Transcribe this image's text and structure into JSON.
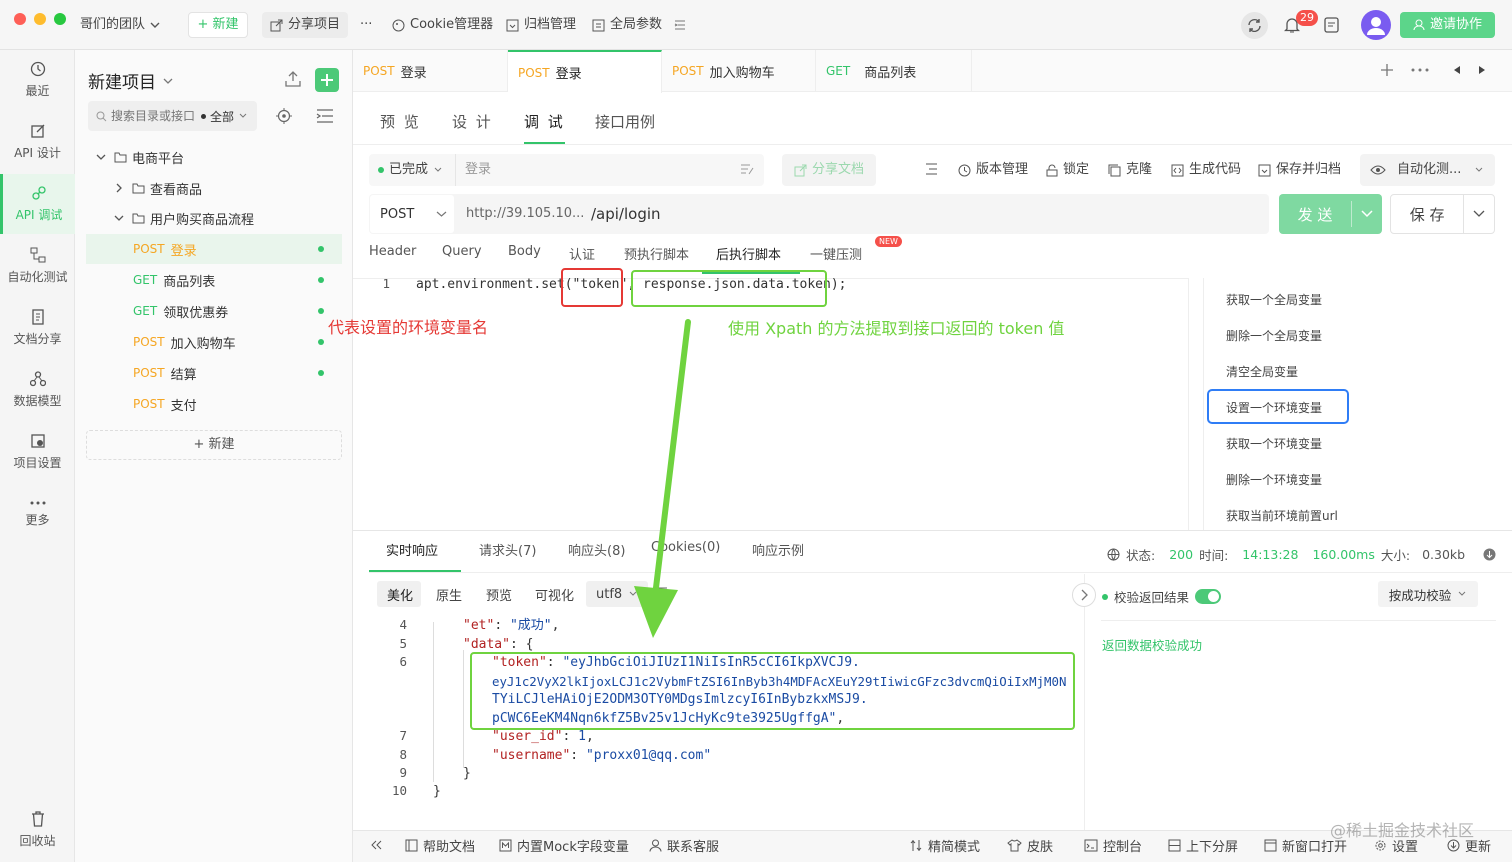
{
  "title_bar": {
    "team": "哥们的团队",
    "new_label": "+ 新建",
    "share_project": "分享项目",
    "more": "···",
    "cookie_manager": "Cookie管理器",
    "archive_manager": "归档管理",
    "global_params": "全局参数",
    "notification_count": "29",
    "invite_label": "邀请协作"
  },
  "rail": {
    "items": [
      {
        "label": "最近",
        "icon": "clock-icon"
      },
      {
        "label": "API 设计",
        "icon": "edit-icon"
      },
      {
        "label": "API 调试",
        "icon": "link-icon"
      },
      {
        "label": "自动化测试",
        "icon": "flow-icon"
      },
      {
        "label": "文档分享",
        "icon": "doc-icon"
      },
      {
        "label": "数据模型",
        "icon": "model-icon"
      },
      {
        "label": "项目设置",
        "icon": "settings-icon"
      },
      {
        "label": "更多",
        "icon": "more-icon"
      }
    ],
    "trash": "回收站"
  },
  "tree": {
    "project_title": "新建项目",
    "search_placeholder": "搜索目录或接口",
    "filter": "全部",
    "nodes": {
      "root": "电商平台",
      "folder1": "查看商品",
      "folder2": "用户购买商品流程"
    },
    "apis": [
      {
        "method": "POST",
        "name": "登录"
      },
      {
        "method": "GET",
        "name": "商品列表"
      },
      {
        "method": "GET",
        "name": "领取优惠券"
      },
      {
        "method": "POST",
        "name": "加入购物车"
      },
      {
        "method": "POST",
        "name": "结算"
      },
      {
        "method": "POST",
        "name": "支付"
      }
    ],
    "new_label": "+ 新建"
  },
  "tabs": [
    {
      "method": "POST",
      "name": "登录"
    },
    {
      "method": "POST",
      "name": "登录"
    },
    {
      "method": "POST",
      "name": "加入购物车"
    },
    {
      "method": "GET",
      "name": "商品列表"
    }
  ],
  "subtabs": [
    "预 览",
    "设 计",
    "调 试",
    "接口用例"
  ],
  "toolbar": {
    "status": "已完成",
    "name": "登录",
    "share_doc": "分享文档",
    "version": "版本管理",
    "lock": "锁定",
    "clone": "克隆",
    "gen_code": "生成代码",
    "save_archive": "保存并归档",
    "auto": "自动化测..."
  },
  "request": {
    "method": "POST",
    "base_url": "http://39.105.10...",
    "path": "/api/login",
    "send": "发 送",
    "save": "保 存"
  },
  "req_tabs": [
    "Header",
    "Query",
    "Body",
    "认证",
    "预执行脚本",
    "后执行脚本",
    "一键压测"
  ],
  "new_badge": "NEW",
  "script": {
    "line_no": "1",
    "code_pre": "apt.environment.set(",
    "code_token": "\"token\"",
    "code_sep": ", ",
    "code_expr": "response.json.data.token);"
  },
  "annotations": {
    "red": "代表设置的环境变量名",
    "green": "使用 Xpath 的方法提取到接口返回的 token 值"
  },
  "snippets": [
    "获取一个全局变量",
    "删除一个全局变量",
    "清空全局变量",
    "设置一个环境变量",
    "获取一个环境变量",
    "删除一个环境变量",
    "获取当前环境前置url"
  ],
  "response": {
    "tabs": [
      "实时响应",
      "请求头(7)",
      "响应头(8)",
      "Cookies(0)",
      "响应示例"
    ],
    "status_label": "状态:",
    "status_code": "200",
    "time_label": "时间:",
    "time": "14:13:28",
    "duration": "160.00ms",
    "size_label": "大小:",
    "size": "0.30kb",
    "formats": [
      "美化",
      "原生",
      "预览",
      "可视化"
    ],
    "encoding": "utf8",
    "validate_label": "校验返回结果",
    "validate_mode": "按成功校验",
    "validate_result": "返回数据校验成功",
    "lines": {
      "l4_no": "4",
      "l4_key": "\"et\"",
      "l4_val": "\"成功\"",
      "l5_no": "5",
      "l5_key": "\"data\"",
      "l6_no": "6",
      "l6_key": "\"token\"",
      "token1": "\"eyJhbGciOiJIUzI1NiIsInR5cCI6IkpXVCJ9.",
      "token2": "eyJ1c2VyX2lkIjoxLCJ1c2VybmFtZSI6InByb3h4MDFAcXEuY29tIiwicGFzc3dvcmQiOiIxMjM0N",
      "token3": "TYiLCJleHAiOjE2ODM3OTY0MDgsImlzcyI6InBybzkxMSJ9.",
      "token4": "pCWC6EeKM4Nqn6kfZ5Bv25v1JcHyKc9te3925UgffgA\"",
      "l7_no": "7",
      "l7_key": "\"user_id\"",
      "l7_val": "1",
      "l8_no": "8",
      "l8_key": "\"username\"",
      "l8_val": "\"proxx01@qq.com\"",
      "l9_no": "9",
      "l10_no": "10"
    }
  },
  "bottom_bar": [
    "帮助文档",
    "内置Mock字段变量",
    "联系客服",
    "精简模式",
    "皮肤",
    "控制台",
    "上下分屏",
    "新窗口打开",
    "设置",
    "更新"
  ],
  "watermark": "@稀土掘金技术社区",
  "colors": {
    "accent": "#33c46a",
    "post": "#f5a623",
    "annotation_red": "#e53935",
    "annotation_green": "#6fd33f",
    "highlight_blue": "#2f7df6"
  }
}
